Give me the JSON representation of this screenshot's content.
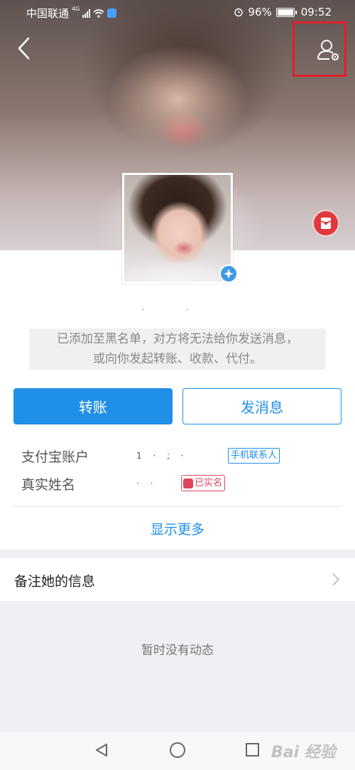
{
  "status_bar": {
    "carrier": "中国联通",
    "network": "4G",
    "battery": "96%",
    "time": "09:52"
  },
  "header": {
    "back_icon": "back-chevron-icon",
    "settings_icon": "user-settings-icon",
    "highlight_color": "#e0202a"
  },
  "profile": {
    "nickname_masked": ". .",
    "verified_icon": "verified-star-icon",
    "blacklist_notice_line1": "已添加至黑名单，对方将无法给你发送消息，",
    "blacklist_notice_line2": "或向你发起转账、收款、代付。"
  },
  "actions": {
    "transfer_label": "转账",
    "message_label": "发消息",
    "accent_color": "#1f8fe8"
  },
  "info": {
    "account_label": "支付宝账户",
    "account_value": "1 · ; ·",
    "account_tag": "手机联系人",
    "name_label": "真实姓名",
    "name_value": "· ·",
    "name_tag": "已实名"
  },
  "show_more_label": "显示更多",
  "remark": {
    "label": "备注她的信息"
  },
  "feed": {
    "empty_text": "暂时没有动态"
  },
  "watermark": "Bai 经验"
}
